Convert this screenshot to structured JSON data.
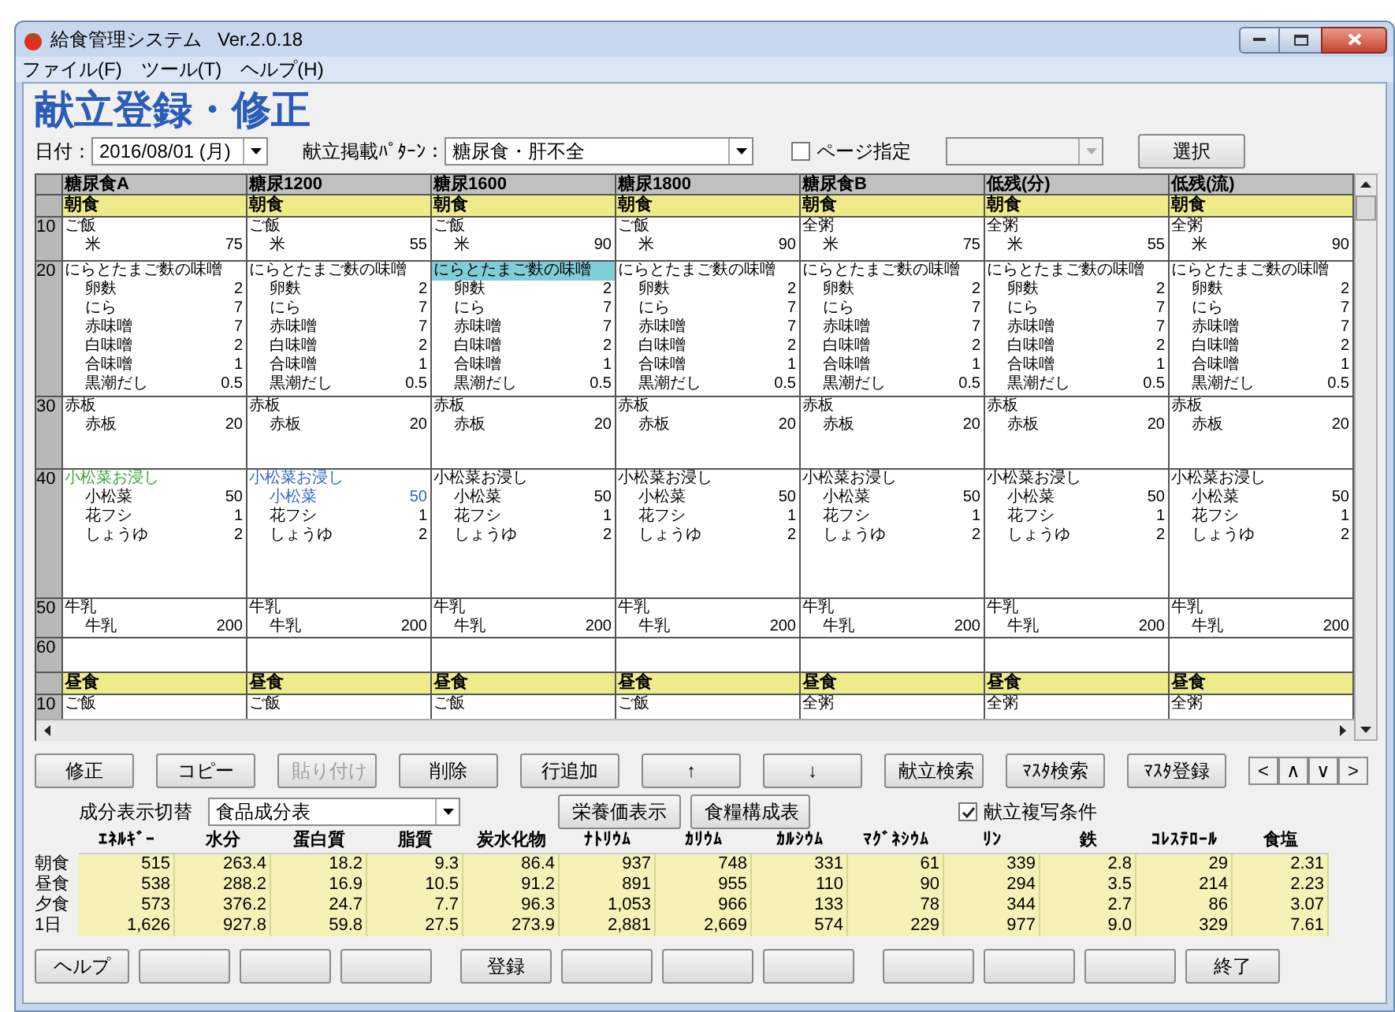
{
  "window": {
    "title": "給食管理システム",
    "version": "Ver.2.0.18"
  },
  "menu": [
    "ファイル(F)",
    "ツール(T)",
    "ヘルプ(H)"
  ],
  "heading": "献立登録・修正",
  "filters": {
    "date_label": "日付：",
    "date": "2016/08/01 (月)",
    "pattern_label": "献立掲載ﾊﾟﾀｰﾝ：",
    "pattern": "糖尿食・肝不全",
    "page_label": "ページ指定",
    "page_checked": false,
    "select_button": "選択"
  },
  "grid": {
    "row_numbers": [
      "10",
      "20",
      "30",
      "40",
      "50",
      "60"
    ],
    "lunch_row_number": "10",
    "columns": [
      {
        "header": "糖尿食A",
        "breakfast": "朝食",
        "lunch": "昼食",
        "lunch_dish": "ご飯",
        "dishes": [
          {
            "name": "ご飯",
            "selected": false,
            "ingredients": [
              {
                "name": "米",
                "amount": "75"
              }
            ]
          },
          {
            "name": "にらとたまご麩の味噌",
            "selected": false,
            "ingredients": [
              {
                "name": "卵麩",
                "amount": "2"
              },
              {
                "name": "にら",
                "amount": "7"
              },
              {
                "name": "赤味噌",
                "amount": "7"
              },
              {
                "name": "白味噌",
                "amount": "2"
              },
              {
                "name": "合味噌",
                "amount": "1"
              },
              {
                "name": "黒潮だし",
                "amount": "0.5"
              }
            ]
          },
          {
            "name": "赤板",
            "selected": false,
            "ingredients": [
              {
                "name": "赤板",
                "amount": "20"
              }
            ]
          },
          {
            "name": "小松菜お浸し",
            "selected": false,
            "color": "#3aa63a",
            "ingredients": [
              {
                "name": "小松菜",
                "amount": "50"
              },
              {
                "name": "花フシ",
                "amount": "1"
              },
              {
                "name": "しょうゆ",
                "amount": "2"
              }
            ]
          },
          {
            "name": "牛乳",
            "selected": false,
            "ingredients": [
              {
                "name": "牛乳",
                "amount": "200"
              }
            ]
          }
        ]
      },
      {
        "header": "糖尿1200",
        "breakfast": "朝食",
        "lunch": "昼食",
        "lunch_dish": "ご飯",
        "dishes": [
          {
            "name": "ご飯",
            "selected": false,
            "ingredients": [
              {
                "name": "米",
                "amount": "55"
              }
            ]
          },
          {
            "name": "にらとたまご麩の味噌",
            "selected": false,
            "ingredients": [
              {
                "name": "卵麩",
                "amount": "2"
              },
              {
                "name": "にら",
                "amount": "7"
              },
              {
                "name": "赤味噌",
                "amount": "7"
              },
              {
                "name": "白味噌",
                "amount": "2"
              },
              {
                "name": "合味噌",
                "amount": "1"
              },
              {
                "name": "黒潮だし",
                "amount": "0.5"
              }
            ]
          },
          {
            "name": "赤板",
            "selected": false,
            "ingredients": [
              {
                "name": "赤板",
                "amount": "20"
              }
            ]
          },
          {
            "name": "小松菜お浸し",
            "selected": false,
            "color": "#2f63c8",
            "ingredients": [
              {
                "name": "小松菜",
                "amount": "50",
                "color": "#2f63c8"
              },
              {
                "name": "花フシ",
                "amount": "1"
              },
              {
                "name": "しょうゆ",
                "amount": "2"
              }
            ]
          },
          {
            "name": "牛乳",
            "selected": false,
            "ingredients": [
              {
                "name": "牛乳",
                "amount": "200"
              }
            ]
          }
        ]
      },
      {
        "header": "糖尿1600",
        "breakfast": "朝食",
        "lunch": "昼食",
        "lunch_dish": "ご飯",
        "dishes": [
          {
            "name": "ご飯",
            "selected": false,
            "ingredients": [
              {
                "name": "米",
                "amount": "90"
              }
            ]
          },
          {
            "name": "にらとたまご麩の味噌",
            "selected": true,
            "ingredients": [
              {
                "name": "卵麩",
                "amount": "2"
              },
              {
                "name": "にら",
                "amount": "7"
              },
              {
                "name": "赤味噌",
                "amount": "7"
              },
              {
                "name": "白味噌",
                "amount": "2"
              },
              {
                "name": "合味噌",
                "amount": "1"
              },
              {
                "name": "黒潮だし",
                "amount": "0.5"
              }
            ]
          },
          {
            "name": "赤板",
            "selected": false,
            "ingredients": [
              {
                "name": "赤板",
                "amount": "20"
              }
            ]
          },
          {
            "name": "小松菜お浸し",
            "selected": false,
            "ingredients": [
              {
                "name": "小松菜",
                "amount": "50"
              },
              {
                "name": "花フシ",
                "amount": "1"
              },
              {
                "name": "しょうゆ",
                "amount": "2"
              }
            ]
          },
          {
            "name": "牛乳",
            "selected": false,
            "ingredients": [
              {
                "name": "牛乳",
                "amount": "200"
              }
            ]
          }
        ]
      },
      {
        "header": "糖尿1800",
        "breakfast": "朝食",
        "lunch": "昼食",
        "lunch_dish": "ご飯",
        "dishes": [
          {
            "name": "ご飯",
            "selected": false,
            "ingredients": [
              {
                "name": "米",
                "amount": "90"
              }
            ]
          },
          {
            "name": "にらとたまご麩の味噌",
            "selected": false,
            "ingredients": [
              {
                "name": "卵麩",
                "amount": "2"
              },
              {
                "name": "にら",
                "amount": "7"
              },
              {
                "name": "赤味噌",
                "amount": "7"
              },
              {
                "name": "白味噌",
                "amount": "2"
              },
              {
                "name": "合味噌",
                "amount": "1"
              },
              {
                "name": "黒潮だし",
                "amount": "0.5"
              }
            ]
          },
          {
            "name": "赤板",
            "selected": false,
            "ingredients": [
              {
                "name": "赤板",
                "amount": "20"
              }
            ]
          },
          {
            "name": "小松菜お浸し",
            "selected": false,
            "ingredients": [
              {
                "name": "小松菜",
                "amount": "50"
              },
              {
                "name": "花フシ",
                "amount": "1"
              },
              {
                "name": "しょうゆ",
                "amount": "2"
              }
            ]
          },
          {
            "name": "牛乳",
            "selected": false,
            "ingredients": [
              {
                "name": "牛乳",
                "amount": "200"
              }
            ]
          }
        ]
      },
      {
        "header": "糖尿食B",
        "breakfast": "朝食",
        "lunch": "昼食",
        "lunch_dish": "全粥",
        "dishes": [
          {
            "name": "全粥",
            "selected": false,
            "ingredients": [
              {
                "name": "米",
                "amount": "75"
              }
            ]
          },
          {
            "name": "にらとたまご麩の味噌",
            "selected": false,
            "ingredients": [
              {
                "name": "卵麩",
                "amount": "2"
              },
              {
                "name": "にら",
                "amount": "7"
              },
              {
                "name": "赤味噌",
                "amount": "7"
              },
              {
                "name": "白味噌",
                "amount": "2"
              },
              {
                "name": "合味噌",
                "amount": "1"
              },
              {
                "name": "黒潮だし",
                "amount": "0.5"
              }
            ]
          },
          {
            "name": "赤板",
            "selected": false,
            "ingredients": [
              {
                "name": "赤板",
                "amount": "20"
              }
            ]
          },
          {
            "name": "小松菜お浸し",
            "selected": false,
            "ingredients": [
              {
                "name": "小松菜",
                "amount": "50"
              },
              {
                "name": "花フシ",
                "amount": "1"
              },
              {
                "name": "しょうゆ",
                "amount": "2"
              }
            ]
          },
          {
            "name": "牛乳",
            "selected": false,
            "ingredients": [
              {
                "name": "牛乳",
                "amount": "200"
              }
            ]
          }
        ]
      },
      {
        "header": "低残(分)",
        "breakfast": "朝食",
        "lunch": "昼食",
        "lunch_dish": "全粥",
        "dishes": [
          {
            "name": "全粥",
            "selected": false,
            "ingredients": [
              {
                "name": "米",
                "amount": "55"
              }
            ]
          },
          {
            "name": "にらとたまご麩の味噌",
            "selected": false,
            "ingredients": [
              {
                "name": "卵麩",
                "amount": "2"
              },
              {
                "name": "にら",
                "amount": "7"
              },
              {
                "name": "赤味噌",
                "amount": "7"
              },
              {
                "name": "白味噌",
                "amount": "2"
              },
              {
                "name": "合味噌",
                "amount": "1"
              },
              {
                "name": "黒潮だし",
                "amount": "0.5"
              }
            ]
          },
          {
            "name": "赤板",
            "selected": false,
            "ingredients": [
              {
                "name": "赤板",
                "amount": "20"
              }
            ]
          },
          {
            "name": "小松菜お浸し",
            "selected": false,
            "ingredients": [
              {
                "name": "小松菜",
                "amount": "50"
              },
              {
                "name": "花フシ",
                "amount": "1"
              },
              {
                "name": "しょうゆ",
                "amount": "2"
              }
            ]
          },
          {
            "name": "牛乳",
            "selected": false,
            "ingredients": [
              {
                "name": "牛乳",
                "amount": "200"
              }
            ]
          }
        ]
      },
      {
        "header": "低残(流)",
        "breakfast": "朝食",
        "lunch": "昼食",
        "lunch_dish": "全粥",
        "dishes": [
          {
            "name": "全粥",
            "selected": false,
            "ingredients": [
              {
                "name": "米",
                "amount": "90"
              }
            ]
          },
          {
            "name": "にらとたまご麩の味噌",
            "selected": false,
            "ingredients": [
              {
                "name": "卵麩",
                "amount": "2"
              },
              {
                "name": "にら",
                "amount": "7"
              },
              {
                "name": "赤味噌",
                "amount": "7"
              },
              {
                "name": "白味噌",
                "amount": "2"
              },
              {
                "name": "合味噌",
                "amount": "1"
              },
              {
                "name": "黒潮だし",
                "amount": "0.5"
              }
            ]
          },
          {
            "name": "赤板",
            "selected": false,
            "ingredients": [
              {
                "name": "赤板",
                "amount": "20"
              }
            ]
          },
          {
            "name": "小松菜お浸し",
            "selected": false,
            "ingredients": [
              {
                "name": "小松菜",
                "amount": "50"
              },
              {
                "name": "花フシ",
                "amount": "1"
              },
              {
                "name": "しょうゆ",
                "amount": "2"
              }
            ]
          },
          {
            "name": "牛乳",
            "selected": false,
            "ingredients": [
              {
                "name": "牛乳",
                "amount": "200"
              }
            ]
          }
        ]
      }
    ]
  },
  "actions": [
    {
      "label": "修正",
      "disabled": false
    },
    {
      "label": "コピー",
      "disabled": false
    },
    {
      "label": "貼り付け",
      "disabled": true
    },
    {
      "label": "削除",
      "disabled": false
    },
    {
      "label": "行追加",
      "disabled": false
    },
    {
      "label": "↑",
      "disabled": false
    },
    {
      "label": "↓",
      "disabled": false
    },
    {
      "label": "献立検索",
      "disabled": false
    },
    {
      "label": "ﾏｽﾀ検索",
      "disabled": false
    },
    {
      "label": "ﾏｽﾀ登録",
      "disabled": false
    }
  ],
  "nav_buttons": [
    "<",
    "∧",
    "∨",
    ">"
  ],
  "nutrition": {
    "switch_label": "成分表示切替",
    "table_source": "食品成分表",
    "show_button": "栄養価表示",
    "composition_button": "食糧構成表",
    "copy_label": "献立複写条件",
    "copy_checked": true,
    "columns": [
      "ｴﾈﾙｷﾞｰ",
      "水分",
      "蛋白質",
      "脂質",
      "炭水化物",
      "ﾅﾄﾘｳﾑ",
      "ｶﾘｳﾑ",
      "ｶﾙｼｳﾑ",
      "ﾏｸﾞﾈｼｳﾑ",
      "ﾘﾝ",
      "鉄",
      "ｺﾚｽﾃﾛｰﾙ",
      "食塩"
    ],
    "rows": [
      {
        "label": "朝食",
        "values": [
          "515",
          "263.4",
          "18.2",
          "9.3",
          "86.4",
          "937",
          "748",
          "331",
          "61",
          "339",
          "2.8",
          "29",
          "2.31"
        ]
      },
      {
        "label": "昼食",
        "values": [
          "538",
          "288.2",
          "16.9",
          "10.5",
          "91.2",
          "891",
          "955",
          "110",
          "90",
          "294",
          "3.5",
          "214",
          "2.23"
        ]
      },
      {
        "label": "夕食",
        "values": [
          "573",
          "376.2",
          "24.7",
          "7.7",
          "96.3",
          "1,053",
          "966",
          "133",
          "78",
          "344",
          "2.7",
          "86",
          "3.07"
        ]
      },
      {
        "label": "1日",
        "values": [
          "1,626",
          "927.8",
          "59.8",
          "27.5",
          "273.9",
          "2,881",
          "2,669",
          "574",
          "229",
          "977",
          "9.0",
          "329",
          "7.61"
        ]
      }
    ]
  },
  "footer": {
    "help": "ヘルプ",
    "register": "登録",
    "exit": "終了"
  }
}
